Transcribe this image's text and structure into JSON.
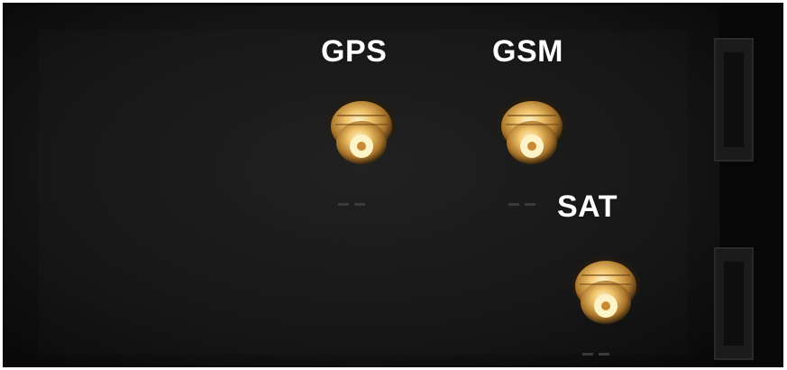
{
  "image": {
    "labels": {
      "gps": "GPS",
      "gsm": "GSM",
      "sat": "SAT"
    },
    "connectors": [
      {
        "id": "gps",
        "icon": "sma-connector-icon"
      },
      {
        "id": "gsm",
        "icon": "sma-connector-icon"
      },
      {
        "id": "sat",
        "icon": "sma-connector-icon"
      }
    ],
    "colors": {
      "panel": "#141414",
      "label_text": "#ffffff",
      "connector_gold": "#d9a448",
      "connector_highlight": "#fff2c0"
    }
  }
}
